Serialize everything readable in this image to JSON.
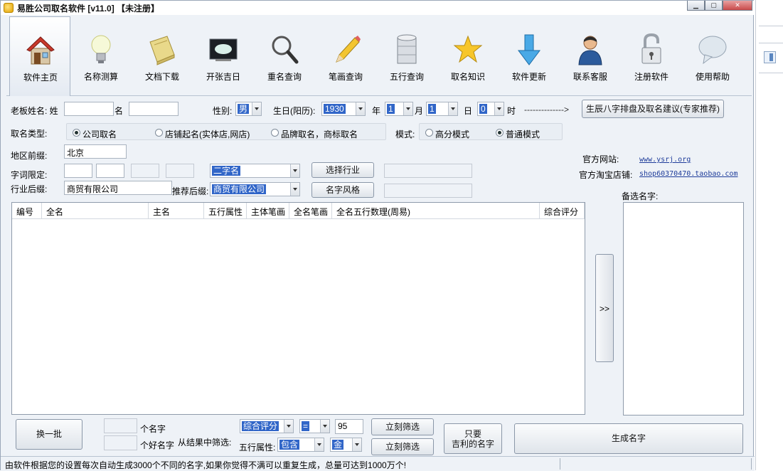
{
  "window": {
    "title": "易胜公司取名软件 [v11.0] 【未注册】"
  },
  "toolbar": [
    {
      "label": "软件主页",
      "icon": "house-icon"
    },
    {
      "label": "名称测算",
      "icon": "lightbulb-icon"
    },
    {
      "label": "文档下载",
      "icon": "book-icon"
    },
    {
      "label": "开张吉日",
      "icon": "monitor-icon"
    },
    {
      "label": "重名查询",
      "icon": "magnifier-icon"
    },
    {
      "label": "笔画查询",
      "icon": "pencil-icon"
    },
    {
      "label": "五行查询",
      "icon": "database-icon"
    },
    {
      "label": "取名知识",
      "icon": "star-icon"
    },
    {
      "label": "软件更新",
      "icon": "down-arrow-icon"
    },
    {
      "label": "联系客服",
      "icon": "person-icon"
    },
    {
      "label": "注册软件",
      "icon": "padlock-icon"
    },
    {
      "label": "使用帮助",
      "icon": "speech-bubble-icon"
    }
  ],
  "form": {
    "boss_label": "老板姓名: 姓",
    "ming_label": "名",
    "gender_label": "性别:",
    "gender": "男",
    "birth_label": "生日(阳历):",
    "year": "1930",
    "year_unit": "年",
    "month": "1",
    "month_unit": "月",
    "day": "1",
    "day_unit": "日",
    "hour": "0",
    "hour_unit": "时",
    "arrow": "-------------->",
    "bazi_button": "生辰八字排盘及取名建议(专家推荐)",
    "type_label": "取名类型:",
    "type_company": "公司取名",
    "type_shop": "店铺起名(实体店,网店)",
    "type_brand": "品牌取名，商标取名",
    "mode_label": "模式:",
    "mode_high": "高分模式",
    "mode_normal": "普通模式",
    "region_label": "地区前缀:",
    "region": "北京",
    "word_limit_label": "字词限定:",
    "name_length": "二字名",
    "select_industry": "选择行业",
    "suffix_label": "行业后缀:",
    "suffix": "商贸有限公司",
    "recommend_label": "推荐后缀:",
    "recommend": "商贸有限公司",
    "name_style": "名字风格",
    "site_label": "官方网站:",
    "site": "www.ysrj.org",
    "shop_label": "官方淘宝店铺:",
    "shop": "shop60370470.taobao.com",
    "candidates_label": "备选名字:"
  },
  "table": {
    "columns": [
      "编号",
      "全名",
      "主名",
      "五行属性",
      "主体笔画",
      "全名笔画",
      "全名五行数理(周易)",
      "综合评分"
    ]
  },
  "transfer_button": ">>",
  "bottom": {
    "swap_button": "换一批",
    "names_count_label": "个名字",
    "good_names_label": "个好名字",
    "filter_label": "从结果中筛选:",
    "filter_field": "综合评分",
    "filter_op": "=",
    "filter_value": "95",
    "filter_now": "立刻筛选",
    "wuxing_label": "五行属性:",
    "wuxing_mode": "包含",
    "wuxing_elem": "金",
    "filter_now2": "立刻筛选",
    "lucky_button_l1": "只要",
    "lucky_button_l2": "吉利的名字",
    "generate_button": "生成名字"
  },
  "status": "由软件根据您的设置每次自动生成3000个不同的名字,如果你觉得不满可以重复生成，总量可达到1000万个!"
}
